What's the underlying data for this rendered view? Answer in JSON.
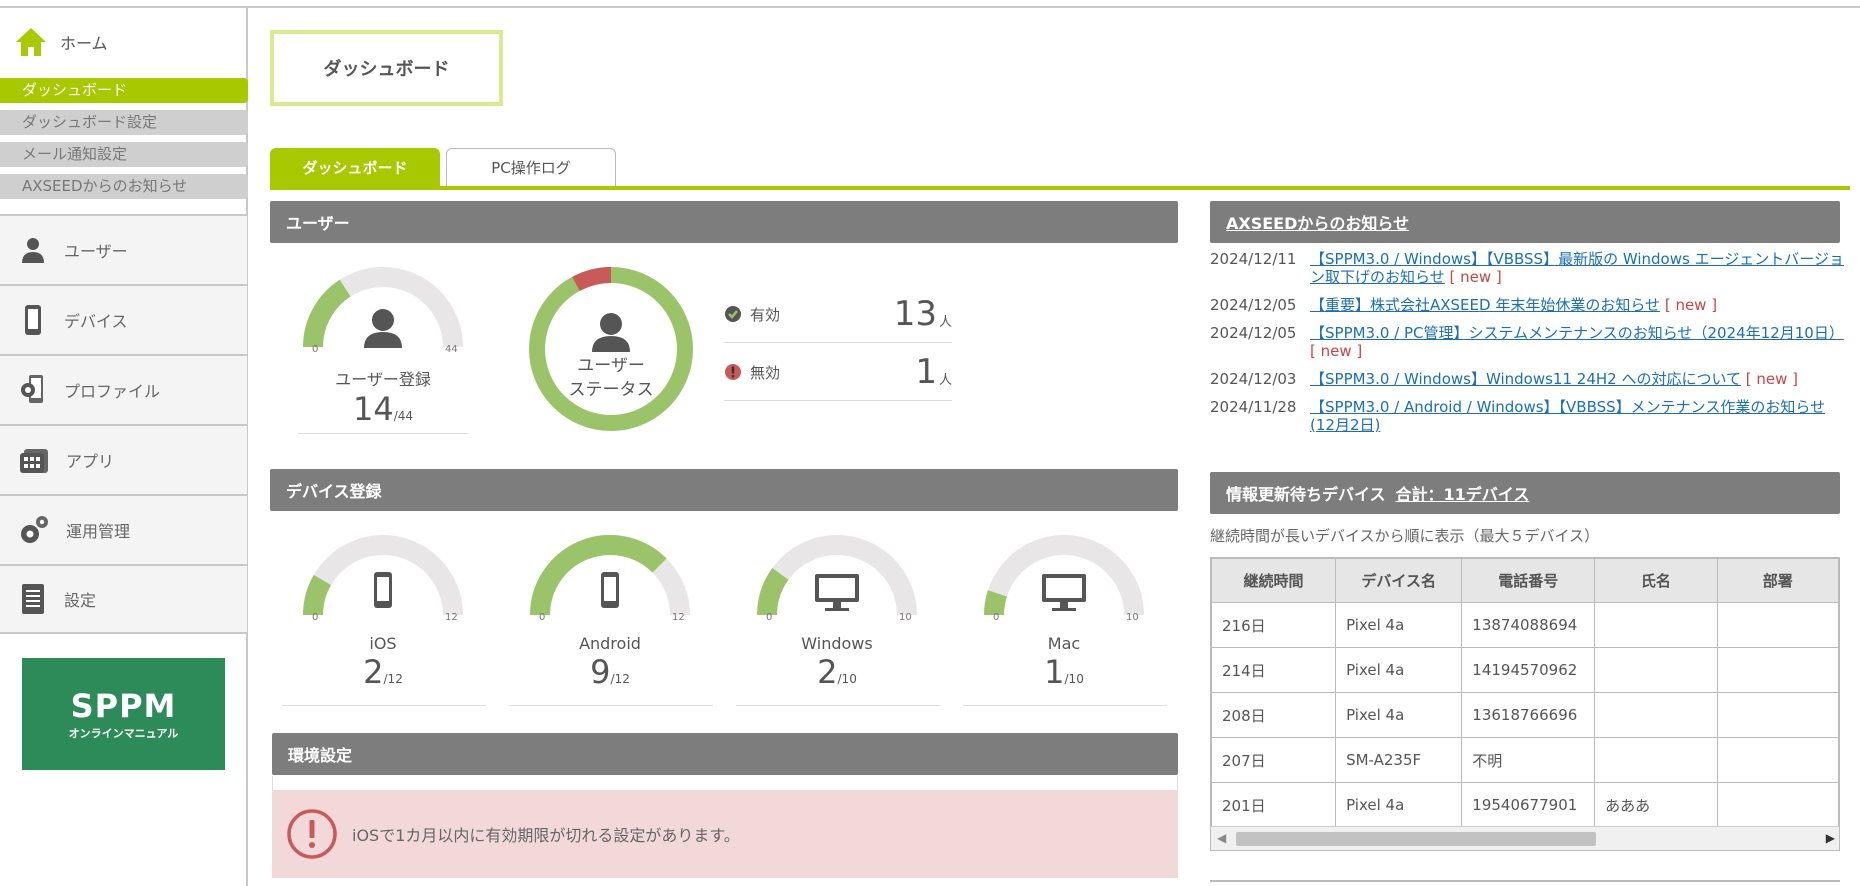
{
  "sidebar": {
    "home_label": "ホーム",
    "subnav": [
      {
        "label": "ダッシュボード",
        "active": true
      },
      {
        "label": "ダッシュボード設定"
      },
      {
        "label": "メール通知設定"
      },
      {
        "label": "AXSEEDからのお知らせ"
      }
    ],
    "mainnav": [
      {
        "label": "ユーザー",
        "icon": "user-icon"
      },
      {
        "label": "デバイス",
        "icon": "phone-icon"
      },
      {
        "label": "プロファイル",
        "icon": "profile-gear-icon"
      },
      {
        "label": "アプリ",
        "icon": "app-grid-icon"
      },
      {
        "label": "運用管理",
        "icon": "gears-icon"
      },
      {
        "label": "設定",
        "icon": "document-icon"
      }
    ],
    "banner": {
      "title": "SPPM",
      "subtitle": "オンラインマニュアル"
    }
  },
  "page_title": "ダッシュボード",
  "tabs": [
    {
      "label": "ダッシュボード",
      "active": true
    },
    {
      "label": "PC操作ログ"
    }
  ],
  "users": {
    "header": "ユーザー",
    "registration": {
      "label": "ユーザー登録",
      "value": 14,
      "max_label": "/44",
      "min": "0",
      "max": "44",
      "fraction": 0.318
    },
    "status": {
      "label_line1": "ユーザー",
      "label_line2": "ステータス",
      "active": {
        "label": "有効",
        "value": "13",
        "unit": "人"
      },
      "inactive": {
        "label": "無効",
        "value": "1",
        "unit": "人"
      }
    }
  },
  "devices": {
    "header": "デバイス登録",
    "items": [
      {
        "label": "iOS",
        "value": "2",
        "max_label": "/12",
        "min": "0",
        "max": "12",
        "fraction": 0.167
      },
      {
        "label": "Android",
        "value": "9",
        "max_label": "/12",
        "min": "0",
        "max": "12",
        "fraction": 0.75
      },
      {
        "label": "Windows",
        "value": "2",
        "max_label": "/10",
        "min": "0",
        "max": "10",
        "fraction": 0.2
      },
      {
        "label": "Mac",
        "value": "1",
        "max_label": "/10",
        "min": "0",
        "max": "10",
        "fraction": 0.1
      }
    ]
  },
  "environment": {
    "header": "環境設定",
    "alert": "iOSで1カ月以内に有効期限が切れる設定があります。"
  },
  "news": {
    "header": "AXSEEDからのお知らせ",
    "new_tag": "[ new ]",
    "items": [
      {
        "date": "2024/12/11",
        "text": "【SPPM3.0 / Windows】【VBBSS】最新版の Windows エージェントバージョン取下げのお知らせ",
        "new": true
      },
      {
        "date": "2024/12/05",
        "text": "【重要】株式会社AXSEED 年末年始休業のお知らせ",
        "new": true
      },
      {
        "date": "2024/12/05",
        "text": "【SPPM3.0 / PC管理】システムメンテナンスのお知らせ（2024年12月10日）",
        "new": true
      },
      {
        "date": "2024/12/03",
        "text": "【SPPM3.0 / Windows】Windows11 24H2 への対応について",
        "new": true
      },
      {
        "date": "2024/11/28",
        "text": "【SPPM3.0 / Android / Windows】【VBBSS】メンテナンス作業のお知らせ(12月2日)",
        "new": false
      }
    ]
  },
  "waiting": {
    "header": "情報更新待ちデバイス",
    "total": "合計：11デバイス",
    "note": "継続時間が長いデバイスから順に表示（最大５デバイス）",
    "columns": [
      "継続時間",
      "デバイス名",
      "電話番号",
      "氏名",
      "部署"
    ],
    "rows": [
      [
        "216日",
        "Pixel 4a",
        "13874088694",
        "",
        ""
      ],
      [
        "214日",
        "Pixel 4a",
        "14194570962",
        "",
        ""
      ],
      [
        "208日",
        "Pixel 4a",
        "13618766696",
        "",
        ""
      ],
      [
        "207日",
        "SM-A235F",
        "不明",
        "",
        ""
      ],
      [
        "201日",
        "Pixel 4a",
        "19540677901",
        "あああ",
        ""
      ]
    ]
  },
  "colors": {
    "accent": "#a8c800",
    "gauge_fill": "#9bc46a",
    "gauge_bg": "#e8e6e6",
    "danger": "#c85a5a",
    "header_gray": "#7d7d7d"
  }
}
